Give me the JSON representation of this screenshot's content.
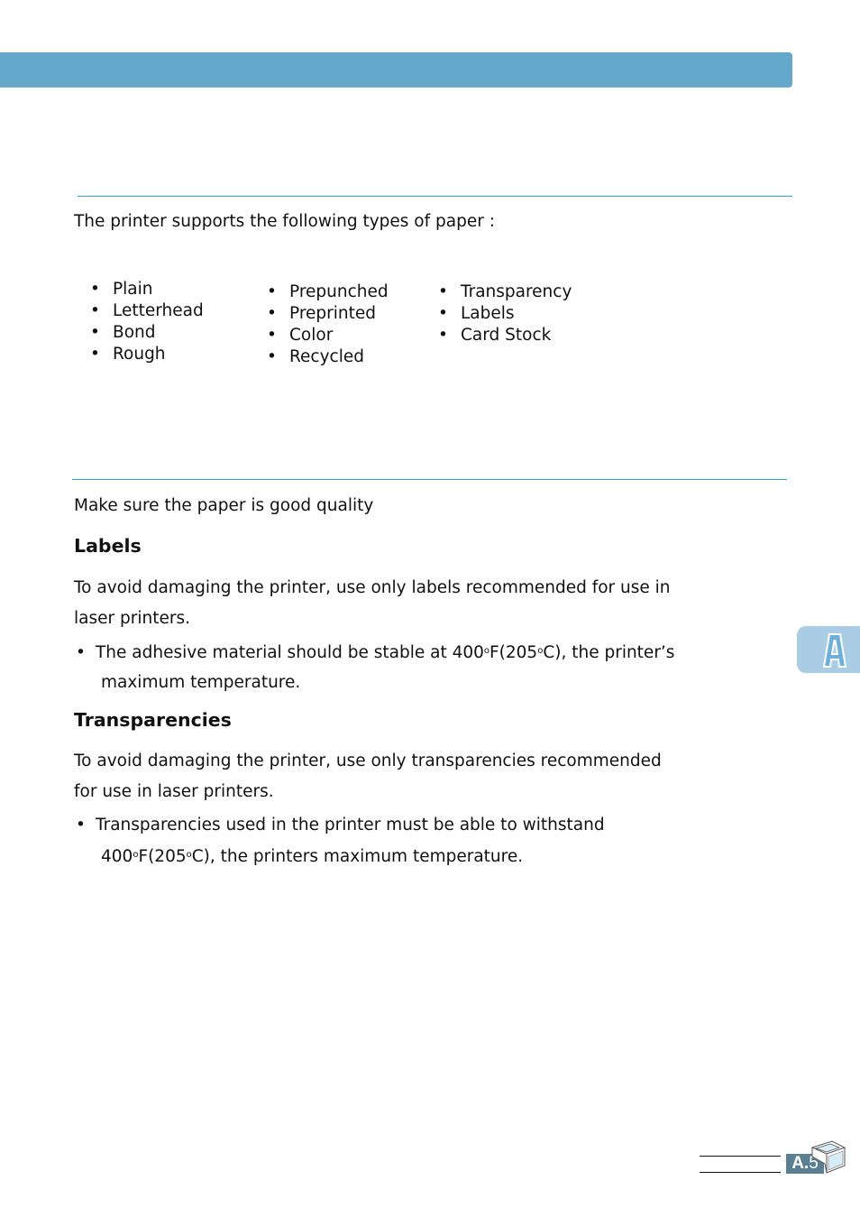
{
  "paper_types": {
    "intro": "The printer supports the following types of paper :",
    "bullet": "•",
    "columns": [
      [
        "Plain",
        "Letterhead",
        "Bond",
        "Rough"
      ],
      [
        "Prepunched",
        "Preprinted",
        "Color",
        "Recycled"
      ],
      [
        "Transparency",
        "Labels",
        "Card Stock"
      ]
    ]
  },
  "guidelines": {
    "intro": "Make sure the paper is good quality",
    "labels": {
      "heading": "Labels",
      "para_line1": "To avoid damaging the printer, use only labels recommended for use in",
      "para_line2": "laser printers.",
      "bullet_part1": "The adhesive material should be stable at 400",
      "bullet_part2": "F(205",
      "bullet_part3": "C), the printer’s",
      "bullet_line2": "maximum temperature."
    },
    "transparencies": {
      "heading": "Transparencies",
      "para_line1": "To avoid damaging the printer, use only transparencies recommended",
      "para_line2": "for use in laser printers.",
      "bullet_line1": "Transparencies used in the printer must be able to withstand",
      "bullet_part1": "400",
      "bullet_part2": "F(205",
      "bullet_part3": "C), the printers maximum temperature."
    },
    "degree_symbol": "o"
  },
  "side_tab": {
    "letter": "A"
  },
  "footer": {
    "page_prefix": "A.",
    "page_number": "5"
  },
  "colors": {
    "band": "#64a8cb",
    "rule": "#2aa5d6",
    "tab": "#a8cde5",
    "badge": "#5a7f93"
  }
}
